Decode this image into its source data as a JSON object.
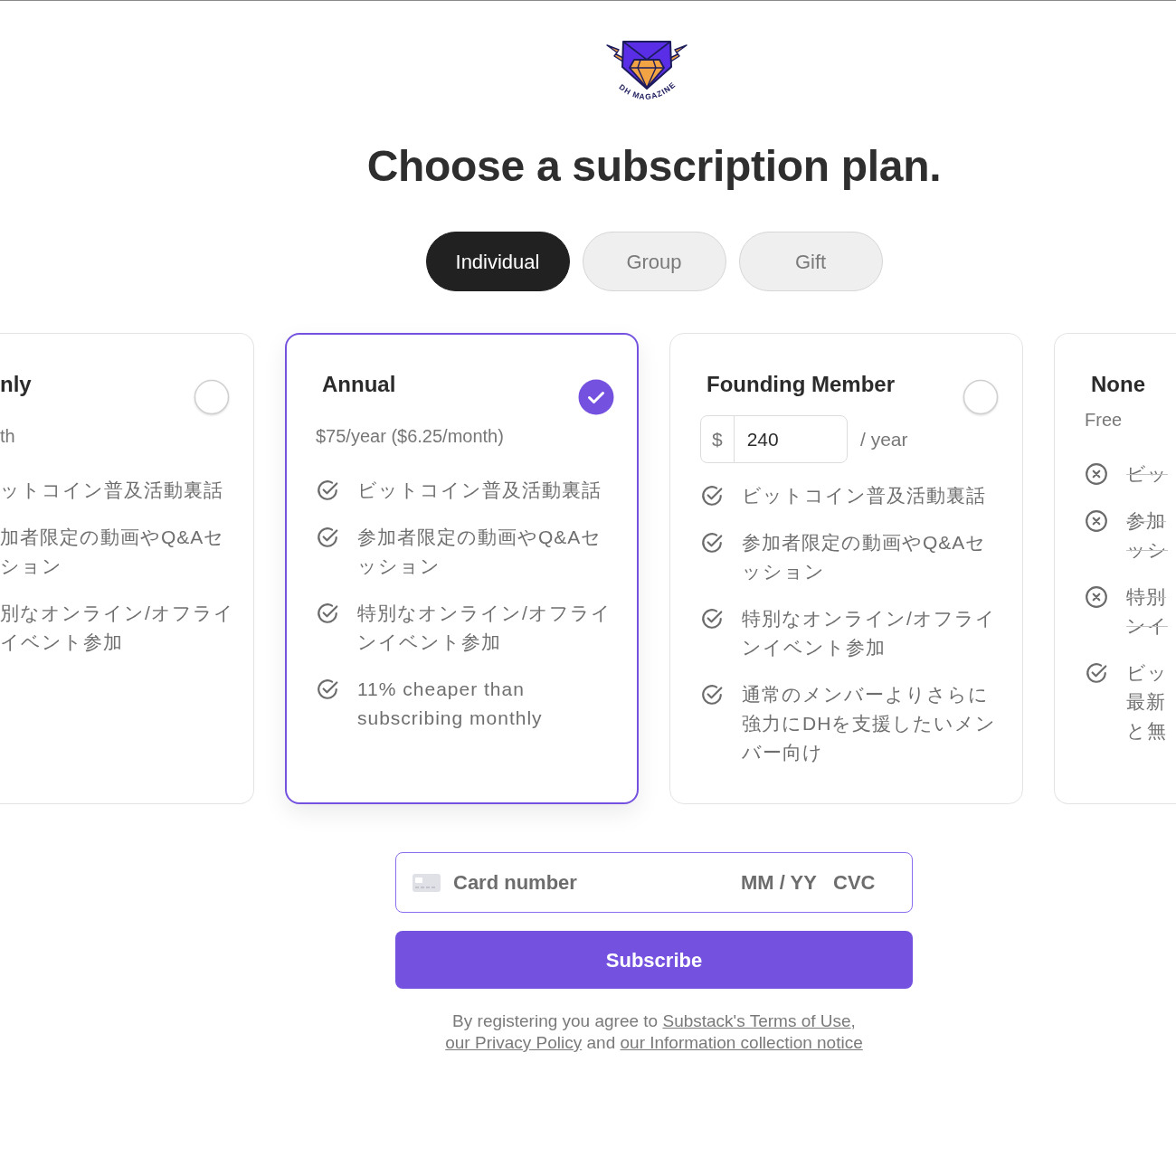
{
  "logo": {
    "wordmark": "DH MAGAZINE"
  },
  "heading": "Choose a subscription plan.",
  "tabs": [
    {
      "label": "Individual",
      "selected": true
    },
    {
      "label": "Group",
      "selected": false
    },
    {
      "label": "Gift",
      "selected": false
    }
  ],
  "plans": [
    {
      "kind": "partial_left",
      "title": "nly",
      "selected": false,
      "price": "th",
      "features": [
        {
          "lines": [
            "ットコイン普及活動裏話"
          ],
          "included": true
        },
        {
          "lines": [
            "加者限定の動画やQ&Aセ",
            "ション"
          ],
          "included": true
        },
        {
          "lines": [
            "別なオンライン/オフライ",
            "イベント参加"
          ],
          "included": true
        }
      ]
    },
    {
      "kind": "full",
      "title": "Annual",
      "selected": true,
      "price": "$75/year ($6.25/month)",
      "features": [
        {
          "text": "ビットコイン普及活動裏話",
          "included": true
        },
        {
          "text": "参加者限定の動画やQ&Aセッション",
          "included": true
        },
        {
          "text": "特別なオンライン/オフラインイベント参加",
          "included": true
        },
        {
          "text": "11% cheaper than subscribing monthly",
          "included": true
        }
      ]
    },
    {
      "kind": "full",
      "title": "Founding Member",
      "selected": false,
      "price_input": {
        "prefix": "$",
        "value": "240",
        "suffix": "/ year"
      },
      "features": [
        {
          "text": "ビットコイン普及活動裏話",
          "included": true
        },
        {
          "text": "参加者限定の動画やQ&Aセッション",
          "included": true
        },
        {
          "text": "特別なオンライン/オフラインイベント参加",
          "included": true
        },
        {
          "text": "通常のメンバーよりさらに強力にDHを支援したいメンバー向け",
          "included": true
        }
      ]
    },
    {
      "kind": "partial_right",
      "title": "None",
      "selected": false,
      "price": "Free",
      "features": [
        {
          "lines": [
            "ビッ"
          ],
          "included": false
        },
        {
          "lines": [
            "参加",
            "ッシ"
          ],
          "included": false
        },
        {
          "lines": [
            "特別",
            "ンイ"
          ],
          "included": false
        },
        {
          "lines": [
            "ビッ",
            "最新",
            "と無"
          ],
          "included": true
        }
      ]
    }
  ],
  "card_form": {
    "focused": true,
    "card_number": {
      "placeholder": "Card number"
    },
    "expiry": {
      "placeholder": "MM / YY"
    },
    "cvc": {
      "placeholder": "CVC"
    }
  },
  "subscribe_button": "Subscribe",
  "legal": [
    {
      "kind": "text",
      "text": "By registering you agree to "
    },
    {
      "kind": "link",
      "text": "Substack's Terms of Use"
    },
    {
      "kind": "text",
      "text": ", "
    },
    {
      "kind": "link",
      "text": "our Privacy Policy"
    },
    {
      "kind": "text",
      "text": " and "
    },
    {
      "kind": "link",
      "text": "our Information collection notice"
    }
  ]
}
